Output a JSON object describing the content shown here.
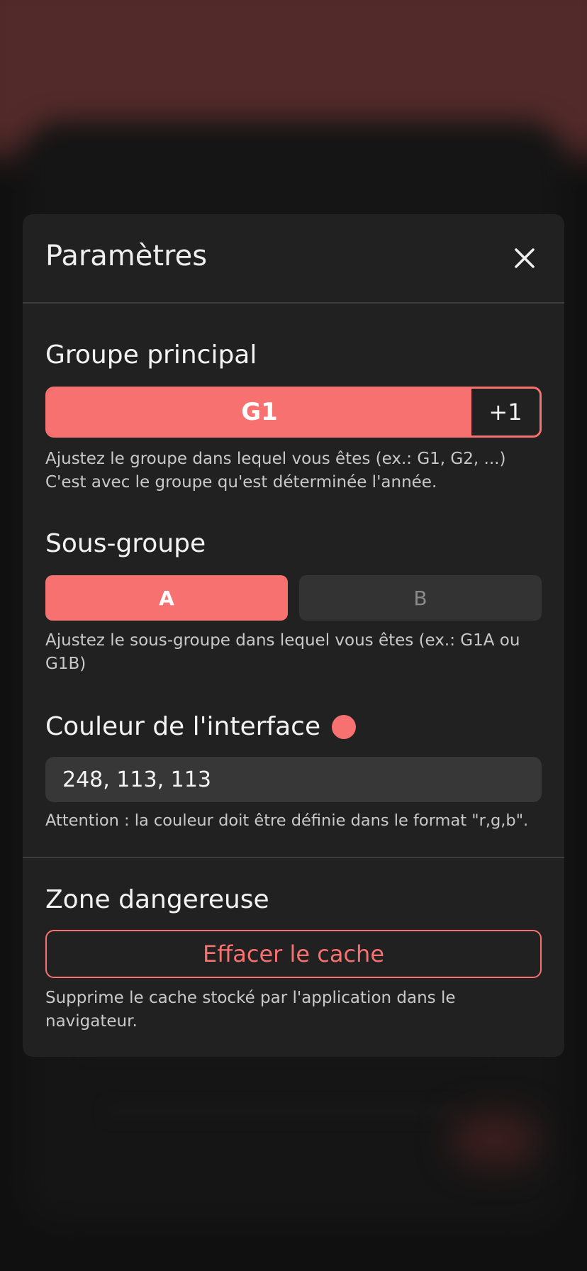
{
  "modal": {
    "title": "Paramètres",
    "close_label": "Fermer"
  },
  "group": {
    "title": "Groupe principal",
    "value": "G1",
    "increment_label": "+1",
    "help_line1": "Ajustez le groupe dans lequel vous êtes (ex.: G1, G2, ...)",
    "help_line2": "C'est avec le groupe qu'est déterminée l'année."
  },
  "subgroup": {
    "title": "Sous-groupe",
    "options": [
      "A",
      "B"
    ],
    "selected": "A",
    "help": "Ajustez le sous-groupe dans lequel vous êtes (ex.: G1A ou G1B)"
  },
  "color": {
    "title": "Couleur de l'interface",
    "value": "248, 113, 113",
    "swatch": "#f87171",
    "help": "Attention : la couleur doit être définie dans le format \"r,g,b\"."
  },
  "danger": {
    "title": "Zone dangereuse",
    "button_label": "Effacer le cache",
    "help": "Supprime le cache stocké par l'application dans le navigateur."
  },
  "theme": {
    "accent": "#f87171",
    "modal_bg": "#212121"
  }
}
